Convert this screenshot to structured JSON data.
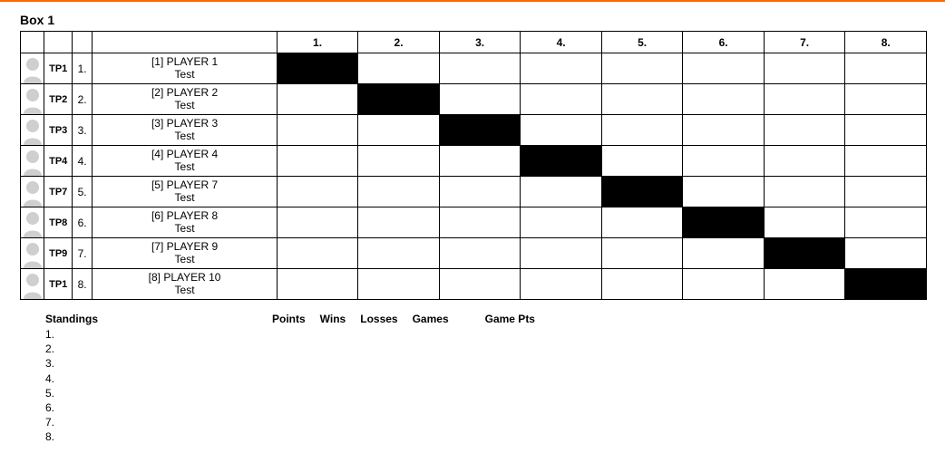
{
  "box": {
    "title": "Box 1",
    "columns": [
      "1.",
      "2.",
      "3.",
      "4.",
      "5.",
      "6.",
      "7.",
      "8."
    ],
    "players": [
      {
        "code": "TP1",
        "row": "1.",
        "seed": "[1]",
        "name": "PLAYER 1",
        "club": "Test"
      },
      {
        "code": "TP2",
        "row": "2.",
        "seed": "[2]",
        "name": "PLAYER 2",
        "club": "Test"
      },
      {
        "code": "TP3",
        "row": "3.",
        "seed": "[3]",
        "name": "PLAYER 3",
        "club": "Test"
      },
      {
        "code": "TP4",
        "row": "4.",
        "seed": "[4]",
        "name": "PLAYER 4",
        "club": "Test"
      },
      {
        "code": "TP7",
        "row": "5.",
        "seed": "[5]",
        "name": "PLAYER 7",
        "club": "Test"
      },
      {
        "code": "TP8",
        "row": "6.",
        "seed": "[6]",
        "name": "PLAYER 8",
        "club": "Test"
      },
      {
        "code": "TP9",
        "row": "7.",
        "seed": "[7]",
        "name": "PLAYER 9",
        "club": "Test"
      },
      {
        "code": "TP1",
        "row": "8.",
        "seed": "[8]",
        "name": "PLAYER 10",
        "club": "Test"
      }
    ]
  },
  "standings": {
    "heading": "Standings",
    "ranks": [
      "1.",
      "2.",
      "3.",
      "4.",
      "5.",
      "6.",
      "7.",
      "8."
    ],
    "columns": [
      "Points",
      "Wins",
      "Losses",
      "Games",
      "Game Pts"
    ]
  }
}
